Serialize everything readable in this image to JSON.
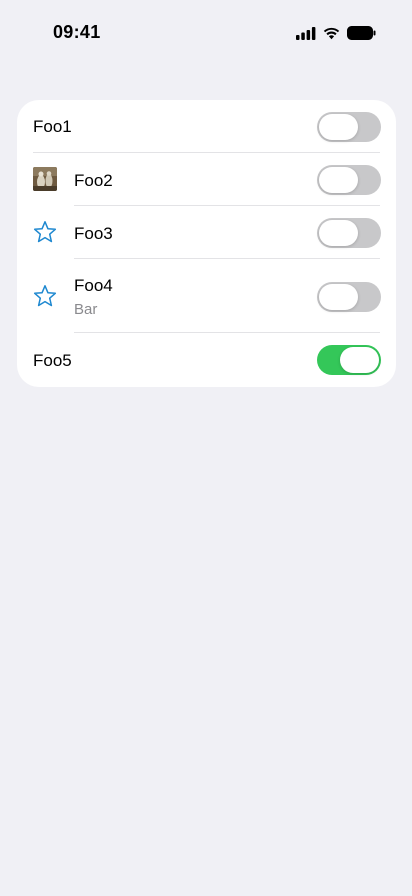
{
  "status_bar": {
    "time": "09:41"
  },
  "settings": {
    "rows": [
      {
        "label": "Foo1",
        "subtitle": "",
        "toggle_on": false,
        "icon": "none"
      },
      {
        "label": "Foo2",
        "subtitle": "",
        "toggle_on": false,
        "icon": "photo-thumbnail-icon"
      },
      {
        "label": "Foo3",
        "subtitle": "",
        "toggle_on": false,
        "icon": "star-icon"
      },
      {
        "label": "Foo4",
        "subtitle": "Bar",
        "toggle_on": false,
        "icon": "star-icon"
      },
      {
        "label": "Foo5",
        "subtitle": "",
        "toggle_on": true,
        "icon": "none"
      }
    ]
  },
  "colors": {
    "background": "#F0F0F5",
    "toggle_on": "#34C759",
    "toggle_off": "#C8C8CA",
    "icon_accent": "#1E88D0"
  }
}
